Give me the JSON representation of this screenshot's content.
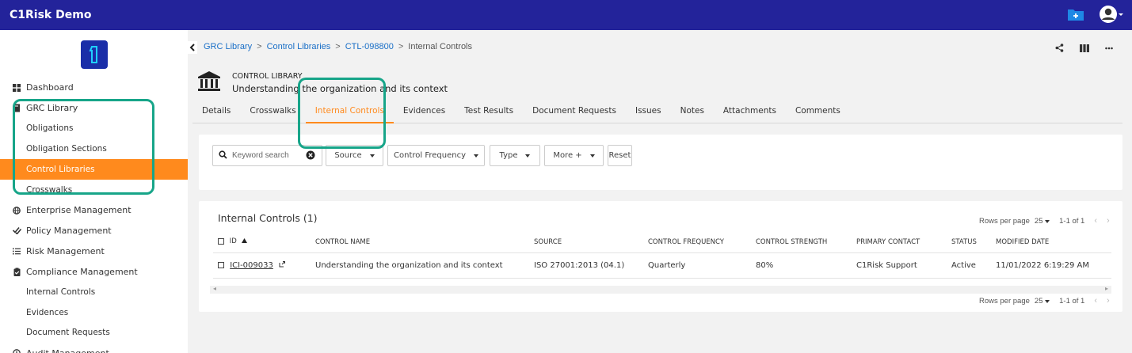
{
  "app": {
    "title": "C1Risk Demo"
  },
  "sidebar": {
    "items": [
      {
        "label": "Dashboard",
        "icon": "grid-icon"
      },
      {
        "label": "GRC Library",
        "icon": "book-icon"
      },
      {
        "label": "Obligations",
        "sub": true
      },
      {
        "label": "Obligation Sections",
        "sub": true
      },
      {
        "label": "Control Libraries",
        "sub": true,
        "active": true
      },
      {
        "label": "Crosswalks",
        "sub": true
      },
      {
        "label": "Enterprise Management",
        "icon": "globe-icon"
      },
      {
        "label": "Policy Management",
        "icon": "check-double-icon"
      },
      {
        "label": "Risk Management",
        "icon": "list-icon"
      },
      {
        "label": "Compliance Management",
        "icon": "clipboard-check-icon"
      },
      {
        "label": "Internal Controls",
        "sub": true
      },
      {
        "label": "Evidences",
        "sub": true
      },
      {
        "label": "Document Requests",
        "sub": true
      },
      {
        "label": "Audit Management",
        "icon": "audit-icon"
      }
    ]
  },
  "breadcrumb": {
    "items": [
      "GRC Library",
      "Control Libraries",
      "CTL-098800"
    ],
    "separator": ">",
    "current": "Internal Controls"
  },
  "header": {
    "label": "CONTROL LIBRARY",
    "name": "Understanding the organization and its context"
  },
  "tabs": [
    "Details",
    "Crosswalks",
    "Internal Controls",
    "Evidences",
    "Test Results",
    "Document Requests",
    "Issues",
    "Notes",
    "Attachments",
    "Comments"
  ],
  "active_tab": "Internal Controls",
  "filters": {
    "search_placeholder": "Keyword search",
    "source": "Source",
    "frequency": "Control Frequency",
    "type": "Type",
    "more": "More +",
    "reset": "Reset"
  },
  "table": {
    "title": "Internal Controls (1)",
    "pager": {
      "rows_label": "Rows per page",
      "rows_value": "25",
      "range": "1-1 of 1"
    },
    "columns": [
      "ID",
      "CONTROL NAME",
      "SOURCE",
      "CONTROL FREQUENCY",
      "CONTROL STRENGTH",
      "PRIMARY CONTACT",
      "STATUS",
      "MODIFIED DATE"
    ],
    "rows": [
      [
        "ICI-009033",
        "Understanding the organization and its context",
        "ISO 27001:2013 (04.1)",
        "Quarterly",
        "80%",
        "C1Risk Support",
        "Active",
        "11/01/2022 6:19:29 AM"
      ]
    ]
  },
  "colors": {
    "topbar": "#23239a",
    "accent": "#ff8a1d",
    "highlight": "#17a589",
    "link": "#1a6fc7"
  }
}
